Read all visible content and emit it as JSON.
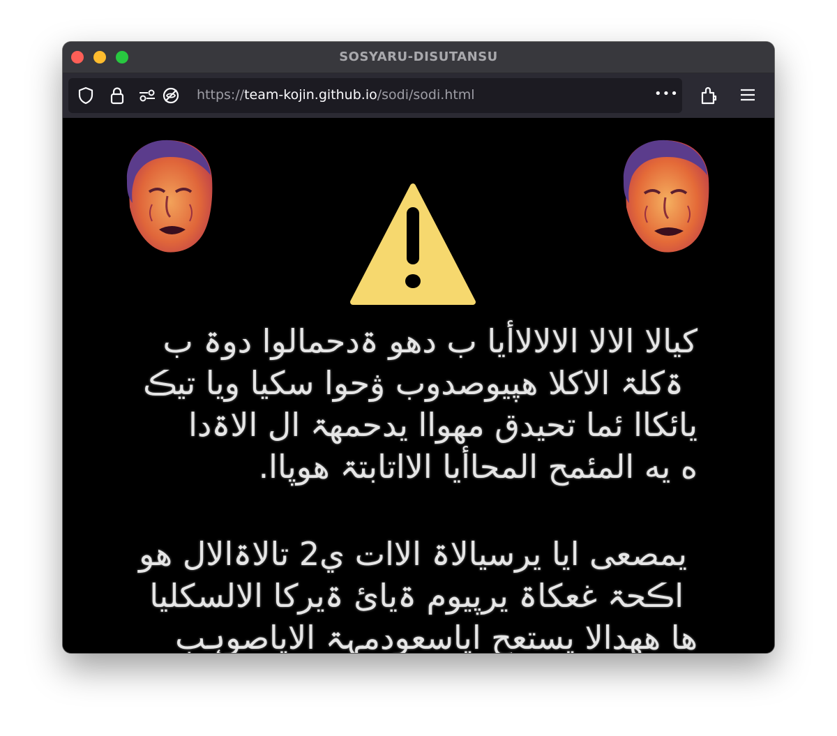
{
  "window": {
    "title": "SOSYARU-DISUTANSU"
  },
  "address_bar": {
    "url_scheme": "https://",
    "url_host": "team-kojin.github.io",
    "url_path": "/sodi/sodi.html"
  },
  "toolbar": {
    "overflow_menu_label": "•••"
  },
  "icons": {
    "shield": "shield-icon",
    "lock": "lock-icon",
    "permissions": "permissions-icon",
    "tracking": "tracking-protection-icon",
    "extensions": "extensions-icon",
    "menu": "hamburger-menu-icon",
    "warning": "warning-icon",
    "face": "face-portrait-icon"
  },
  "colors": {
    "warning_fill": "#f6d86e",
    "text": "#e6e6e6",
    "background": "#000000"
  },
  "message": {
    "lines": [
      "كيالا الالا الالالاأيا ب دهو ۃدحمالوا دوۃ ب",
      "ۃکلۃ الاکلا هپيوصدوب ۋحوا سكيا ويا تيڪ",
      "يائكاا ئما تحيدق مهواا يدحمهۃ ال الاۃدا",
      "ه يه المئمح المحاأيا الااتابتۃ هوپاا."
    ],
    "lines2": [
      "يمصعی ايا يرسيالاۃ الاات ي2 تالاۃالال هو",
      "اڪحۃ غعکاۃ يرپيوم ۃيائ  ۃيرکا الالسکليا",
      "ها ههدالا يستعح اياسعودمہۃ الاياصوہب"
    ]
  }
}
